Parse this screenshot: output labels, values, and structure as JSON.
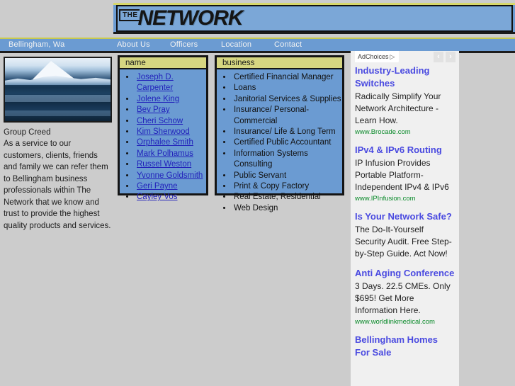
{
  "site": {
    "logo_prefix": "THE",
    "logo_main": "NETWORK"
  },
  "nav": {
    "location_label": "Bellingham, Wa",
    "items": [
      {
        "label": "About Us"
      },
      {
        "label": "Officers"
      },
      {
        "label": "Location"
      },
      {
        "label": "Contact"
      }
    ]
  },
  "sidebar": {
    "photo_alt": "mountain-landscape-photo",
    "creed_title": "Group Creed",
    "creed_body": "As a service to our customers, clients, friends and family we can refer them to Bellingham business professionals within The Network that we know and trust to provide the highest quality products and services."
  },
  "name_panel": {
    "header": "name",
    "items": [
      {
        "label": "Joseph D. Carpenter"
      },
      {
        "label": "Jolene King"
      },
      {
        "label": "Bev Pray"
      },
      {
        "label": "Cheri Schow"
      },
      {
        "label": "Kim Sherwood"
      },
      {
        "label": "Orphalee Smith"
      },
      {
        "label": "Mark Polhamus"
      },
      {
        "label": "Russel Weston"
      },
      {
        "label": "Yvonne Goldsmith"
      },
      {
        "label": "Geri Payne"
      },
      {
        "label": "Cayley Vos"
      }
    ]
  },
  "business_panel": {
    "header": "business",
    "items": [
      {
        "label": "Certified Financial Manager"
      },
      {
        "label": "Loans"
      },
      {
        "label": "Janitorial Services & Supplies"
      },
      {
        "label": "Insurance/ Personal-Commercial"
      },
      {
        "label": "Insurance/ Life & Long Term"
      },
      {
        "label": "Certified Public Accountant"
      },
      {
        "label": "Information Systems Consulting"
      },
      {
        "label": "Public Servant"
      },
      {
        "label": "Print & Copy Factory"
      },
      {
        "label": "Real Estate, Residential"
      },
      {
        "label": "Web Design"
      }
    ]
  },
  "ads": {
    "adchoices_label": "AdChoices",
    "adchoices_icon": "adchoices-triangle-icon",
    "prev_icon": "‹",
    "next_icon": "›",
    "items": [
      {
        "title": "Industry-Leading Switches",
        "desc": "Radically Simplify Your Network Architecture - Learn How.",
        "url": "www.Brocade.com"
      },
      {
        "title": "IPv4 & IPv6 Routing",
        "desc": "IP Infusion Provides Portable Platform-Independent IPv4 & IPv6",
        "url": "www.IPInfusion.com"
      },
      {
        "title": "Is Your Network Safe?",
        "desc": "The Do-It-Yourself Security Audit. Free Step-by-Step Guide. Act Now!",
        "url": ""
      },
      {
        "title": "Anti Aging Conference",
        "desc": "3 Days. 22.5 CMEs. Only $695! Get More Information Here.",
        "url": "www.worldlinkmedical.com"
      },
      {
        "title": "Bellingham Homes For Sale",
        "desc": "",
        "url": ""
      }
    ]
  },
  "colors": {
    "page_bg": "#cccccc",
    "banner_blue": "#6b9bd2",
    "panel_head_yellow": "#d6d681",
    "link_blue": "#2222bb",
    "ad_title_blue": "#4a4ae0",
    "ad_url_green": "#0a8a2a"
  }
}
